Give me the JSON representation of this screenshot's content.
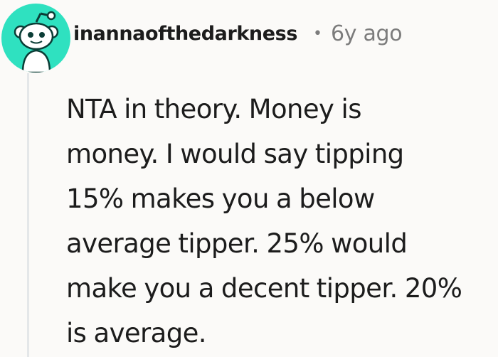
{
  "comment": {
    "avatar_icon": "reddit-snoo-avatar-icon",
    "avatar_color": "#2fe1c0",
    "username": "inannaofthedarkness",
    "separator": "•",
    "age": "6y ago",
    "body": "NTA in theory. Money is\nmoney. I would say tipping\n15% makes you a below\naverage tipper. 25% would\nmake you a decent tipper. 20%\nis average."
  }
}
